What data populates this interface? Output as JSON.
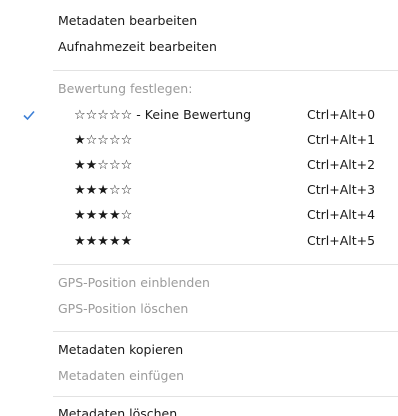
{
  "menu": {
    "edit_metadata": "Metadaten bearbeiten",
    "edit_capture_time": "Aufnahmezeit bearbeiten",
    "set_rating_header": "Bewertung festlegen:",
    "ratings": [
      {
        "stars_filled": 0,
        "stars_text": "☆☆☆☆☆",
        "suffix": " - Keine Bewertung",
        "shortcut": "Ctrl+Alt+0",
        "checked": true
      },
      {
        "stars_filled": 1,
        "stars_text": "★☆☆☆☆",
        "suffix": "",
        "shortcut": "Ctrl+Alt+1",
        "checked": false
      },
      {
        "stars_filled": 2,
        "stars_text": "★★☆☆☆",
        "suffix": "",
        "shortcut": "Ctrl+Alt+2",
        "checked": false
      },
      {
        "stars_filled": 3,
        "stars_text": "★★★☆☆",
        "suffix": "",
        "shortcut": "Ctrl+Alt+3",
        "checked": false
      },
      {
        "stars_filled": 4,
        "stars_text": "★★★★☆",
        "suffix": "",
        "shortcut": "Ctrl+Alt+4",
        "checked": false
      },
      {
        "stars_filled": 5,
        "stars_text": "★★★★★",
        "suffix": "",
        "shortcut": "Ctrl+Alt+5",
        "checked": false
      }
    ],
    "show_gps": "GPS-Position einblenden",
    "delete_gps": "GPS-Position löschen",
    "copy_metadata": "Metadaten kopieren",
    "paste_metadata": "Metadaten einfügen",
    "delete_metadata": "Metadaten löschen"
  },
  "colors": {
    "check": "#3c7fd6",
    "disabled_text": "#9b9b9b",
    "separator": "#e2e2e2"
  }
}
